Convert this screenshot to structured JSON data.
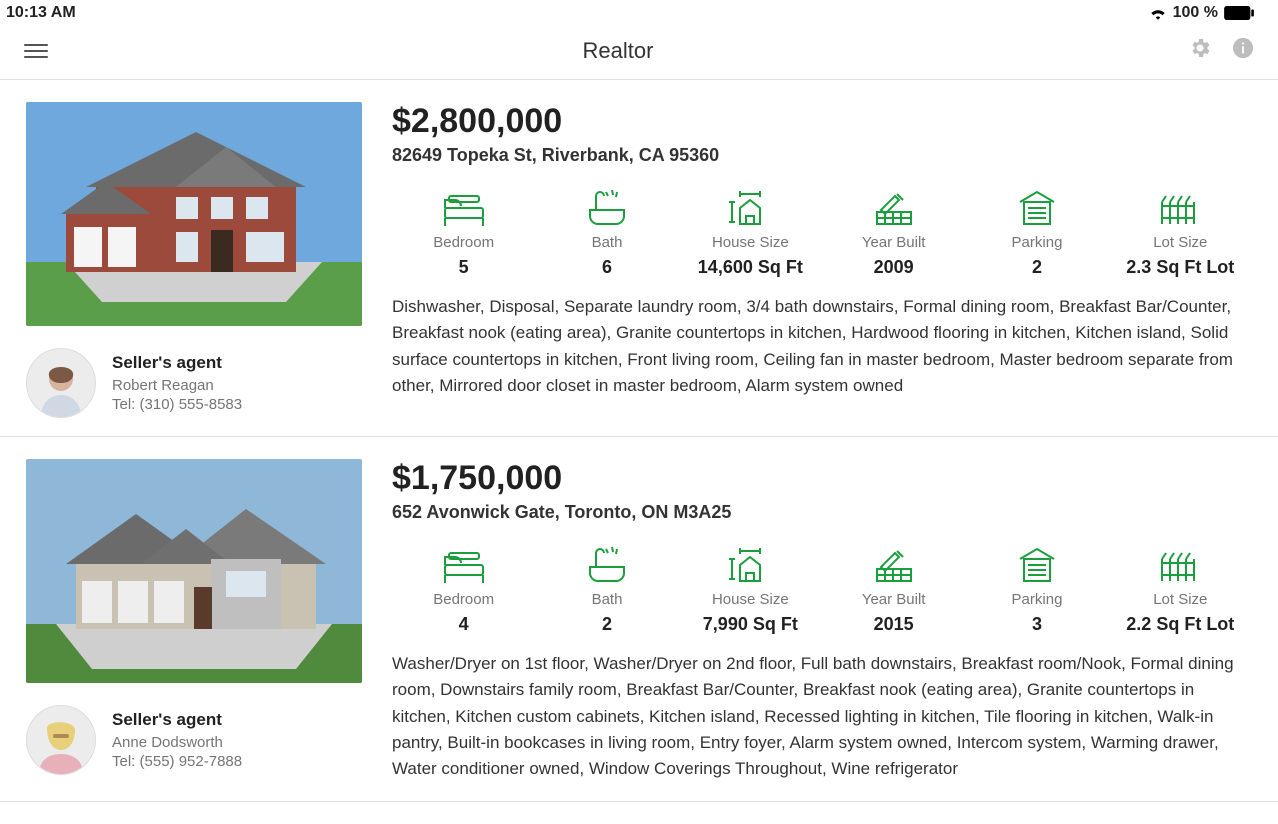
{
  "status": {
    "time": "10:13 AM",
    "battery": "100 %"
  },
  "header": {
    "title": "Realtor"
  },
  "stat_labels": {
    "bedroom": "Bedroom",
    "bath": "Bath",
    "house_size": "House Size",
    "year_built": "Year Built",
    "parking": "Parking",
    "lot_size": "Lot Size"
  },
  "agent_role_label": "Seller's agent",
  "tel_prefix": "Tel: ",
  "listings": [
    {
      "price": "$2,800,000",
      "address": "82649 Topeka St, Riverbank, CA 95360",
      "stats": {
        "bedroom": "5",
        "bath": "6",
        "house_size": "14,600 Sq Ft",
        "year_built": "2009",
        "parking": "2",
        "lot_size": "2.3 Sq Ft Lot"
      },
      "description": "Dishwasher, Disposal, Separate laundry room, 3/4 bath downstairs, Formal dining room, Breakfast Bar/Counter, Breakfast nook (eating area), Granite countertops in kitchen, Hardwood flooring in kitchen, Kitchen island, Solid surface countertops in kitchen, Front living room, Ceiling fan in master bedroom, Master bedroom separate from other, Mirrored door closet in master bedroom, Alarm system owned",
      "agent": {
        "name": "Robert Reagan",
        "tel": "(310) 555-8583"
      }
    },
    {
      "price": "$1,750,000",
      "address": "652 Avonwick Gate, Toronto, ON M3A25",
      "stats": {
        "bedroom": "4",
        "bath": "2",
        "house_size": "7,990 Sq Ft",
        "year_built": "2015",
        "parking": "3",
        "lot_size": "2.2 Sq Ft Lot"
      },
      "description": "Washer/Dryer on 1st floor, Washer/Dryer on 2nd floor, Full bath downstairs, Breakfast room/Nook, Formal dining room, Downstairs family room, Breakfast Bar/Counter, Breakfast nook (eating area), Granite countertops in kitchen, Kitchen custom cabinets, Kitchen island, Recessed lighting in kitchen, Tile flooring in kitchen, Walk-in pantry, Built-in bookcases in living room, Entry foyer, Alarm system owned, Intercom system, Warming drawer, Water conditioner owned, Window Coverings Throughout, Wine refrigerator",
      "agent": {
        "name": "Anne Dodsworth",
        "tel": "(555) 952-7888"
      }
    }
  ]
}
